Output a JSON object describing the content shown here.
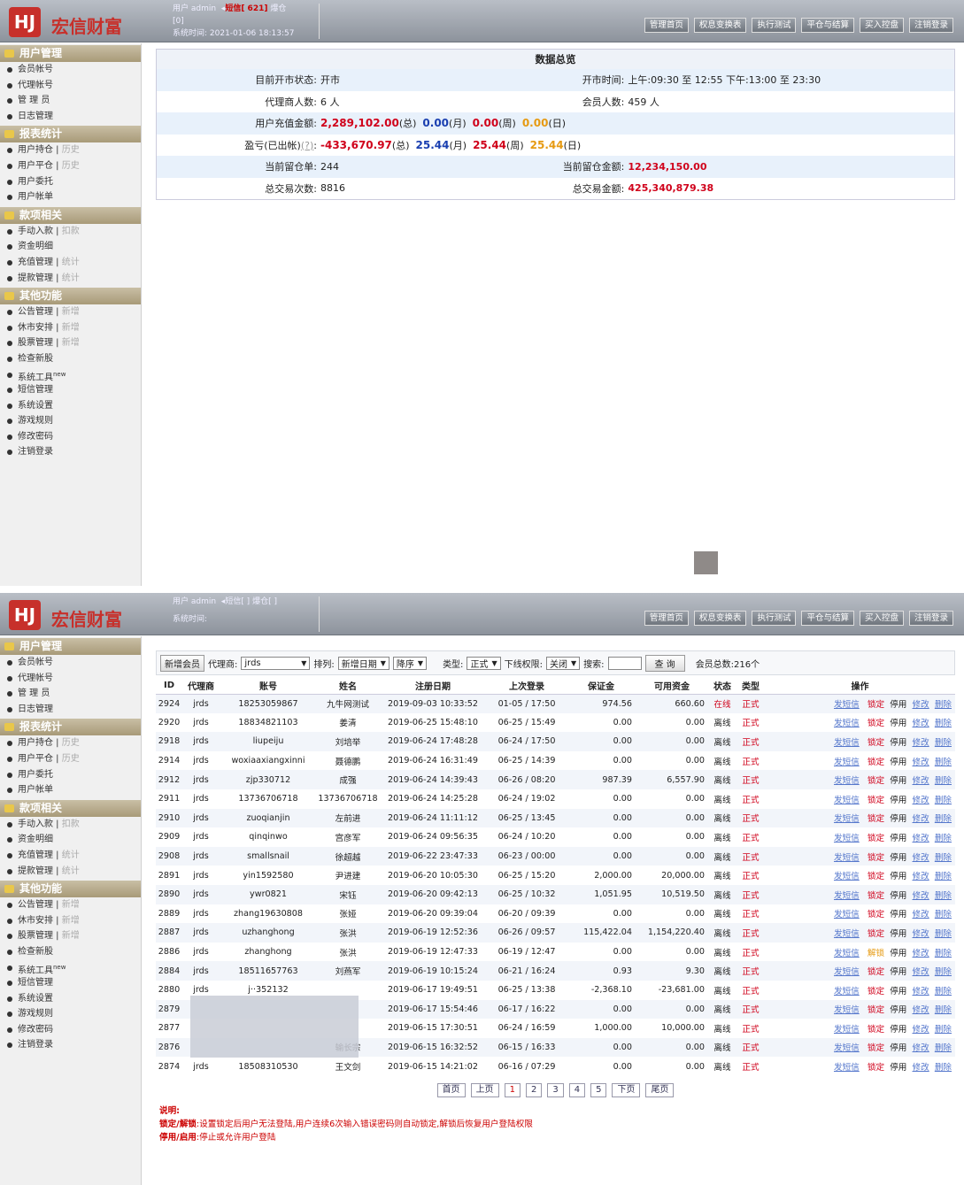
{
  "header": {
    "brand": "宏信财富",
    "logo_mark": "HJ",
    "user_line1": "用户 admin",
    "sms": "短信[ 621]",
    "position": "爆仓",
    "user_line2": "[0]",
    "systime": "系统时间: 2021-01-06 18:13:57",
    "p2_user_line1": "用户 admin",
    "p2_sms": "短信[ ]",
    "p2_position": "爆仓[ ]",
    "p2_systime": "系统时间:",
    "nav": [
      "管理首页",
      "权息变换表",
      "执行测试",
      "平仓与结算",
      "买入控盘",
      "注销登录"
    ]
  },
  "sidebar": [
    {
      "title": "用户管理",
      "items": [
        {
          "label": "会员帐号"
        },
        {
          "label": "代理帐号"
        },
        {
          "label": "管 理 员"
        },
        {
          "label": "日志管理"
        }
      ]
    },
    {
      "title": "报表统计",
      "items": [
        {
          "label": "用户持仓",
          "sub": "历史"
        },
        {
          "label": "用户平仓",
          "sub": "历史"
        },
        {
          "label": "用户委托"
        },
        {
          "label": "用户帐单"
        }
      ]
    },
    {
      "title": "款项相关",
      "items": [
        {
          "label": "手动入款",
          "sub": "扣款"
        },
        {
          "label": "资金明细"
        },
        {
          "label": "充值管理",
          "sub": "统计"
        },
        {
          "label": "提款管理",
          "sub": "统计"
        }
      ]
    },
    {
      "title": "其他功能",
      "items": [
        {
          "label": "公告管理",
          "sub": "新增"
        },
        {
          "label": "休市安排",
          "sub": "新增"
        },
        {
          "label": "股票管理",
          "sub": "新增"
        },
        {
          "label": "检查新股"
        },
        {
          "label": "系统工具",
          "sup": "new"
        },
        {
          "label": "短信管理"
        },
        {
          "label": "系统设置"
        },
        {
          "label": "游戏规则"
        },
        {
          "label": "修改密码"
        },
        {
          "label": "注销登录"
        }
      ]
    }
  ],
  "overview": {
    "title": "数据总览",
    "market_label": "目前开市状态:",
    "market_value": "开市",
    "hours_label": "开市时间:",
    "hours_value": "上午:09:30 至 12:55   下午:13:00 至 23:30",
    "agents_label": "代理商人数:",
    "agents_value": "6 人",
    "members_label": "会员人数:",
    "members_value": "459 人",
    "recharge_label": "用户充值金额:",
    "recharge_total": "2,289,102.00",
    "recharge_month": "0.00",
    "recharge_week": "0.00",
    "recharge_day": "0.00",
    "pnl_label": "盈亏(已出帐)",
    "pnl_q": "(?)",
    "pnl_total": "-433,670.97",
    "pnl_month": "25.44",
    "pnl_week": "25.44",
    "pnl_day": "25.44",
    "t_total": "(总)",
    "t_month": "(月)",
    "t_week": "(周)",
    "t_day": "(日)",
    "hold_label": "当前留仓单:",
    "hold_value": "244",
    "hold_amt_label": "当前留仓金额:",
    "hold_amt_value": "12,234,150.00",
    "trades_label": "总交易次数:",
    "trades_value": "8816",
    "trade_amt_label": "总交易金额:",
    "trade_amt_value": "425,340,879.38"
  },
  "filters": {
    "add": "新增会员",
    "agent_label": "代理商:",
    "agent_value": "jrds",
    "sort_label": "排列:",
    "sort_value": "新增日期",
    "order_value": "降序",
    "type_label": "类型:",
    "type_value": "正式",
    "perm_label": "下线权限:",
    "perm_value": "关闭",
    "search_label": "搜索:",
    "search_btn": "查 询",
    "total": "会员总数:216个"
  },
  "columns": [
    "ID",
    "代理商",
    "账号",
    "姓名",
    "注册日期",
    "上次登录",
    "保证金",
    "可用资金",
    "状态",
    "类型",
    "操作"
  ],
  "actions": {
    "sms": "发短信",
    "lock": "锁定",
    "unlock": "解锁",
    "stop": "停用",
    "edit": "修改",
    "del": "删除"
  },
  "rows": [
    {
      "id": "2924",
      "agent": "jrds",
      "acct": "18253059867",
      "name": "九牛网测试",
      "reg": "2019-09-03 10:33:52",
      "last": "01-05 / 17:50",
      "margin": "974.56",
      "avail": "660.60",
      "status": "在线",
      "type": "正式",
      "lock": "锁定"
    },
    {
      "id": "2920",
      "agent": "jrds",
      "acct": "18834821103",
      "name": "姜清",
      "reg": "2019-06-25 15:48:10",
      "last": "06-25 / 15:49",
      "margin": "0.00",
      "avail": "0.00",
      "status": "离线",
      "type": "正式",
      "lock": "锁定"
    },
    {
      "id": "2918",
      "agent": "jrds",
      "acct": "liupeiju",
      "name": "刘培举",
      "reg": "2019-06-24 17:48:28",
      "last": "06-24 / 17:50",
      "margin": "0.00",
      "avail": "0.00",
      "status": "离线",
      "type": "正式",
      "lock": "锁定"
    },
    {
      "id": "2914",
      "agent": "jrds",
      "acct": "woxiaaxiangxinni",
      "name": "聂德鹏",
      "reg": "2019-06-24 16:31:49",
      "last": "06-25 / 14:39",
      "margin": "0.00",
      "avail": "0.00",
      "status": "离线",
      "type": "正式",
      "lock": "锁定"
    },
    {
      "id": "2912",
      "agent": "jrds",
      "acct": "zjp330712",
      "name": "成强",
      "reg": "2019-06-24 14:39:43",
      "last": "06-26 / 08:20",
      "margin": "987.39",
      "avail": "6,557.90",
      "status": "离线",
      "type": "正式",
      "lock": "锁定"
    },
    {
      "id": "2911",
      "agent": "jrds",
      "acct": "13736706718",
      "name": "13736706718",
      "reg": "2019-06-24 14:25:28",
      "last": "06-24 / 19:02",
      "margin": "0.00",
      "avail": "0.00",
      "status": "离线",
      "type": "正式",
      "lock": "锁定"
    },
    {
      "id": "2910",
      "agent": "jrds",
      "acct": "zuoqianjin",
      "name": "左前进",
      "reg": "2019-06-24 11:11:12",
      "last": "06-25 / 13:45",
      "margin": "0.00",
      "avail": "0.00",
      "status": "离线",
      "type": "正式",
      "lock": "锁定"
    },
    {
      "id": "2909",
      "agent": "jrds",
      "acct": "qinqinwo",
      "name": "宫彦军",
      "reg": "2019-06-24 09:56:35",
      "last": "06-24 / 10:20",
      "margin": "0.00",
      "avail": "0.00",
      "status": "离线",
      "type": "正式",
      "lock": "锁定"
    },
    {
      "id": "2908",
      "agent": "jrds",
      "acct": "smallsnail",
      "name": "徐超越",
      "reg": "2019-06-22 23:47:33",
      "last": "06-23 / 00:00",
      "margin": "0.00",
      "avail": "0.00",
      "status": "离线",
      "type": "正式",
      "lock": "锁定"
    },
    {
      "id": "2891",
      "agent": "jrds",
      "acct": "yin1592580",
      "name": "尹进建",
      "reg": "2019-06-20 10:05:30",
      "last": "06-25 / 15:20",
      "margin": "2,000.00",
      "avail": "20,000.00",
      "status": "离线",
      "type": "正式",
      "lock": "锁定"
    },
    {
      "id": "2890",
      "agent": "jrds",
      "acct": "ywr0821",
      "name": "宋钰",
      "reg": "2019-06-20 09:42:13",
      "last": "06-25 / 10:32",
      "margin": "1,051.95",
      "avail": "10,519.50",
      "status": "离线",
      "type": "正式",
      "lock": "锁定"
    },
    {
      "id": "2889",
      "agent": "jrds",
      "acct": "zhang19630808",
      "name": "张娅",
      "reg": "2019-06-20 09:39:04",
      "last": "06-20 / 09:39",
      "margin": "0.00",
      "avail": "0.00",
      "status": "离线",
      "type": "正式",
      "lock": "锁定"
    },
    {
      "id": "2887",
      "agent": "jrds",
      "acct": "uzhanghong",
      "name": "张洪",
      "reg": "2019-06-19 12:52:36",
      "last": "06-26 / 09:57",
      "margin": "115,422.04",
      "avail": "1,154,220.40",
      "status": "离线",
      "type": "正式",
      "lock": "锁定"
    },
    {
      "id": "2886",
      "agent": "jrds",
      "acct": "zhanghong",
      "name": "张洪",
      "reg": "2019-06-19 12:47:33",
      "last": "06-19 / 12:47",
      "margin": "0.00",
      "avail": "0.00",
      "status": "离线",
      "type": "正式",
      "lock": "解锁"
    },
    {
      "id": "2884",
      "agent": "jrds",
      "acct": "18511657763",
      "name": "刘燕军",
      "reg": "2019-06-19 10:15:24",
      "last": "06-21 / 16:24",
      "margin": "0.93",
      "avail": "9.30",
      "status": "离线",
      "type": "正式",
      "lock": "锁定"
    },
    {
      "id": "2880",
      "agent": "jrds",
      "acct": "j··352132",
      "name": "",
      "reg": "2019-06-17 19:49:51",
      "last": "06-25 / 13:38",
      "margin": "-2,368.10",
      "avail": "-23,681.00",
      "status": "离线",
      "type": "正式",
      "lock": "锁定"
    },
    {
      "id": "2879",
      "agent": "",
      "acct": "",
      "name": "",
      "reg": "2019-06-17 15:54:46",
      "last": "06-17 / 16:22",
      "margin": "0.00",
      "avail": "0.00",
      "status": "离线",
      "type": "正式",
      "lock": "锁定"
    },
    {
      "id": "2877",
      "agent": "",
      "acct": "",
      "name": "",
      "reg": "2019-06-15 17:30:51",
      "last": "06-24 / 16:59",
      "margin": "1,000.00",
      "avail": "10,000.00",
      "status": "离线",
      "type": "正式",
      "lock": "锁定"
    },
    {
      "id": "2876",
      "agent": "",
      "acct": "",
      "name": "输长宗",
      "reg": "2019-06-15 16:32:52",
      "last": "06-15 / 16:33",
      "margin": "0.00",
      "avail": "0.00",
      "status": "离线",
      "type": "正式",
      "lock": "锁定"
    },
    {
      "id": "2874",
      "agent": "jrds",
      "acct": "18508310530",
      "name": "王文剑",
      "reg": "2019-06-15 14:21:02",
      "last": "06-16 / 07:29",
      "margin": "0.00",
      "avail": "0.00",
      "status": "离线",
      "type": "正式",
      "lock": "锁定"
    }
  ],
  "pager": [
    "首页",
    "上页",
    "1",
    "2",
    "3",
    "4",
    "5",
    "下页",
    "尾页"
  ],
  "notes": {
    "title": "说明:",
    "lock_label": "锁定/解锁",
    "lock_text": ":设置锁定后用户无法登陆,用户连续6次输入错误密码则自动锁定,解锁后恢复用户登陆权限",
    "stop_label": "停用/启用",
    "stop_text": ":停止或允许用户登陆"
  }
}
